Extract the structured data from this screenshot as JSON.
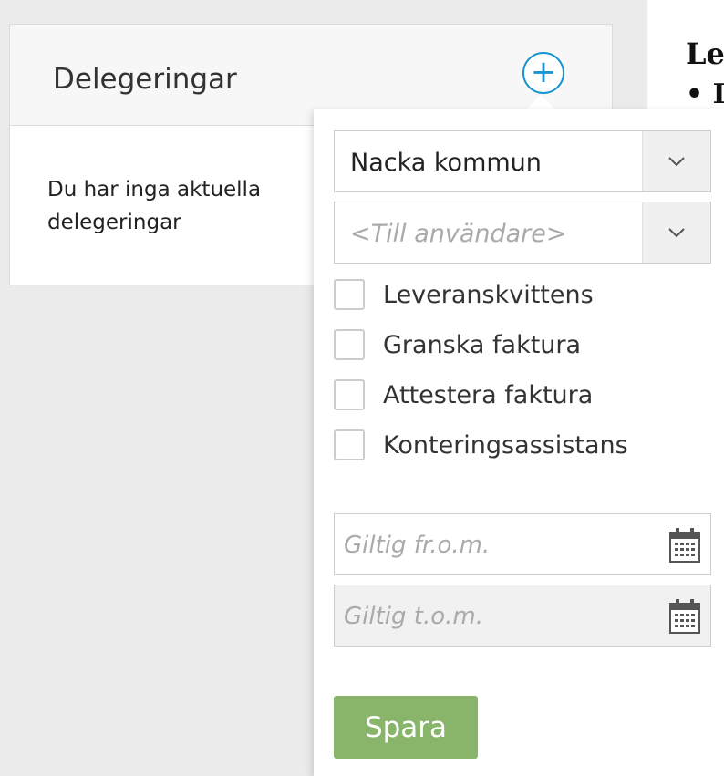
{
  "card": {
    "title": "Delegeringar",
    "empty_message": "Du har inga aktuella delegeringar",
    "add_icon": "plus-circle-icon"
  },
  "background_text": {
    "heading": "Le",
    "bullet": "• I"
  },
  "popover": {
    "organization_select": {
      "value": "Nacka kommun",
      "icon": "chevron-down-icon"
    },
    "user_select": {
      "placeholder": "<Till användare>",
      "icon": "chevron-down-icon"
    },
    "roles": [
      {
        "label": "Leveranskvittens",
        "checked": false
      },
      {
        "label": "Granska faktura",
        "checked": false
      },
      {
        "label": "Attestera faktura",
        "checked": false
      },
      {
        "label": "Konteringsassistans",
        "checked": false
      }
    ],
    "valid_from": {
      "placeholder": "Giltig fr.o.m.",
      "icon": "calendar-icon"
    },
    "valid_to": {
      "placeholder": "Giltig t.o.m.",
      "icon": "calendar-icon"
    },
    "save_label": "Spara"
  },
  "colors": {
    "accent": "#1a93d1",
    "save_button": "#88b56a",
    "page_background": "#ebebeb"
  }
}
